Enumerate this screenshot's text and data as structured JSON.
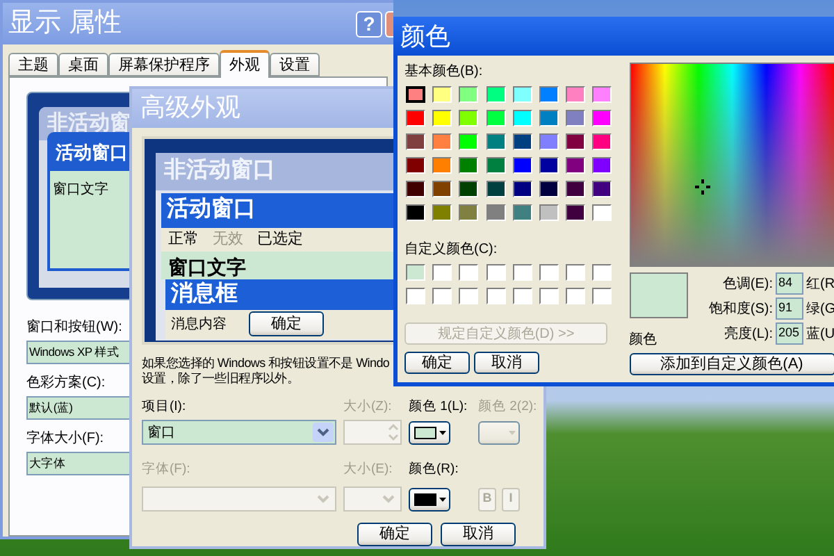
{
  "display_properties": {
    "title": "显示 属性",
    "help_button": "?",
    "tabs": [
      {
        "label": "主题",
        "selected": false
      },
      {
        "label": "桌面",
        "selected": false
      },
      {
        "label": "屏幕保护程序",
        "selected": false
      },
      {
        "label": "外观",
        "selected": true
      },
      {
        "label": "设置",
        "selected": false
      }
    ],
    "preview": {
      "inactive_title": "非活动窗",
      "active_title": "活动窗口",
      "window_text": "窗口文字"
    },
    "fields": [
      {
        "label": "窗口和按钮(W):",
        "value": "Windows XP 样式"
      },
      {
        "label": "色彩方案(C):",
        "value": "默认(蓝)"
      },
      {
        "label": "字体大小(F):",
        "value": "大字体"
      }
    ]
  },
  "advanced_appearance": {
    "title": "高级外观",
    "preview": {
      "inactive_title": "非活动窗口",
      "active_title": "活动窗口",
      "menu_items": [
        {
          "label": "正常",
          "disabled": false
        },
        {
          "label": "无效",
          "disabled": true
        },
        {
          "label": "已选定",
          "disabled": false
        }
      ],
      "window_text": "窗口文字",
      "message_title": "消息框",
      "message_text": "消息内容",
      "ok_button": "确定"
    },
    "note_lines": [
      "如果您选择的 Windows 和按钮设置不是 Windo",
      "设置，除了一些旧程序以外。"
    ],
    "item": {
      "label": "项目(I):",
      "value": "窗口"
    },
    "size": {
      "label": "大小(Z):",
      "disabled": true
    },
    "color1": {
      "label": "颜色 1(L):",
      "color": "#cce8d2",
      "disabled": false
    },
    "color2": {
      "label": "颜色 2(2):",
      "disabled": true
    },
    "font": {
      "label": "字体(F):",
      "disabled": true
    },
    "font_size": {
      "label": "大小(E):",
      "disabled": true
    },
    "font_color": {
      "label": "颜色(R):",
      "color": "#000000",
      "disabled": false
    },
    "style_buttons": [
      {
        "label": "B",
        "disabled": true
      },
      {
        "label": "I",
        "disabled": true
      }
    ],
    "buttons": [
      "确定",
      "取消"
    ]
  },
  "color_dialog": {
    "title": "颜色",
    "basic_label": "基本颜色(B):",
    "basic_colors": [
      {
        "color": "#ff8080",
        "selected": true
      },
      {
        "color": "#ffff80",
        "selected": false
      },
      {
        "color": "#80ff80",
        "selected": false
      },
      {
        "color": "#00ff80",
        "selected": false
      },
      {
        "color": "#80ffff",
        "selected": false
      },
      {
        "color": "#0080ff",
        "selected": false
      },
      {
        "color": "#ff80c0",
        "selected": false
      },
      {
        "color": "#ff80ff",
        "selected": false
      },
      {
        "color": "#ff0000",
        "selected": false
      },
      {
        "color": "#ffff00",
        "selected": false
      },
      {
        "color": "#80ff00",
        "selected": false
      },
      {
        "color": "#00ff40",
        "selected": false
      },
      {
        "color": "#00ffff",
        "selected": false
      },
      {
        "color": "#0080c0",
        "selected": false
      },
      {
        "color": "#8080c0",
        "selected": false
      },
      {
        "color": "#ff00ff",
        "selected": false
      },
      {
        "color": "#804040",
        "selected": false
      },
      {
        "color": "#ff8040",
        "selected": false
      },
      {
        "color": "#00ff00",
        "selected": false
      },
      {
        "color": "#008080",
        "selected": false
      },
      {
        "color": "#004080",
        "selected": false
      },
      {
        "color": "#8080ff",
        "selected": false
      },
      {
        "color": "#800040",
        "selected": false
      },
      {
        "color": "#ff0080",
        "selected": false
      },
      {
        "color": "#800000",
        "selected": false
      },
      {
        "color": "#ff8000",
        "selected": false
      },
      {
        "color": "#008000",
        "selected": false
      },
      {
        "color": "#008040",
        "selected": false
      },
      {
        "color": "#0000ff",
        "selected": false
      },
      {
        "color": "#0000a0",
        "selected": false
      },
      {
        "color": "#800080",
        "selected": false
      },
      {
        "color": "#8000ff",
        "selected": false
      },
      {
        "color": "#400000",
        "selected": false
      },
      {
        "color": "#804000",
        "selected": false
      },
      {
        "color": "#004000",
        "selected": false
      },
      {
        "color": "#004040",
        "selected": false
      },
      {
        "color": "#000080",
        "selected": false
      },
      {
        "color": "#000040",
        "selected": false
      },
      {
        "color": "#400040",
        "selected": false
      },
      {
        "color": "#400080",
        "selected": false
      },
      {
        "color": "#000000",
        "selected": false
      },
      {
        "color": "#808000",
        "selected": false
      },
      {
        "color": "#808040",
        "selected": false
      },
      {
        "color": "#808080",
        "selected": false
      },
      {
        "color": "#408080",
        "selected": false
      },
      {
        "color": "#c0c0c0",
        "selected": false
      },
      {
        "color": "#400040",
        "selected": false
      },
      {
        "color": "#ffffff",
        "selected": false
      }
    ],
    "custom_label": "自定义颜色(C):",
    "custom_colors": [
      {
        "color": "#cce8d2"
      },
      {
        "color": "#ffffff"
      },
      {
        "color": "#ffffff"
      },
      {
        "color": "#ffffff"
      },
      {
        "color": "#ffffff"
      },
      {
        "color": "#ffffff"
      },
      {
        "color": "#ffffff"
      },
      {
        "color": "#ffffff"
      },
      {
        "color": "#ffffff"
      },
      {
        "color": "#ffffff"
      },
      {
        "color": "#ffffff"
      },
      {
        "color": "#ffffff"
      },
      {
        "color": "#ffffff"
      },
      {
        "color": "#ffffff"
      },
      {
        "color": "#ffffff"
      },
      {
        "color": "#ffffff"
      }
    ],
    "define_button": {
      "label": "规定自定义颜色(D) >>",
      "disabled": true
    },
    "buttons": [
      "确定",
      "取消"
    ],
    "preview": {
      "label": "颜色",
      "color": "#cce8d2"
    },
    "values": [
      {
        "label": "色调(E):",
        "value": "84",
        "channel": "红(R"
      },
      {
        "label": "饱和度(S):",
        "value": "91",
        "channel": "绿(G"
      },
      {
        "label": "亮度(L):",
        "value": "205",
        "channel": "蓝(U"
      }
    ],
    "add_button": "添加到自定义颜色(A)"
  }
}
